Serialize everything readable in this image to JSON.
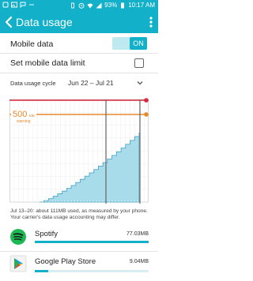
{
  "status_bar": {
    "battery_percent": "93%",
    "time": "10:17 AM",
    "icons": [
      "vibrate-icon",
      "alarm-icon",
      "wifi-icon",
      "signal-icon",
      "battery-icon"
    ],
    "left_icons": [
      "notification-icon",
      "image-icon",
      "chat-icon",
      "dots-icon"
    ]
  },
  "app_bar": {
    "title": "Data usage",
    "color": "#13b0c9"
  },
  "mobile_data": {
    "label": "Mobile data",
    "toggle_label": "ON",
    "enabled": true
  },
  "limit": {
    "label": "Set mobile data limit",
    "checked": false
  },
  "cycle": {
    "label": "Data usage cycle",
    "value": "Jun 22 – Jul 21"
  },
  "chart": {
    "warning_value": "500",
    "warning_unit": "MB",
    "warning_text": "warning",
    "warning_color": "#e8892c",
    "limit_color": "#d7263d",
    "fill_color": "#a9dcea",
    "line_color": "#3d9fc4"
  },
  "note": "Jul 13–20: about 111MB used, as measured by your phone. Your carrier's data usage accounting may differ.",
  "apps": [
    {
      "name": "Spotify",
      "size": "77.03MB",
      "fraction": 1.0,
      "icon": "spotify-icon"
    },
    {
      "name": "Google Play Store",
      "size": "9.04MB",
      "fraction": 0.12,
      "icon": "play-store-icon"
    }
  ]
}
